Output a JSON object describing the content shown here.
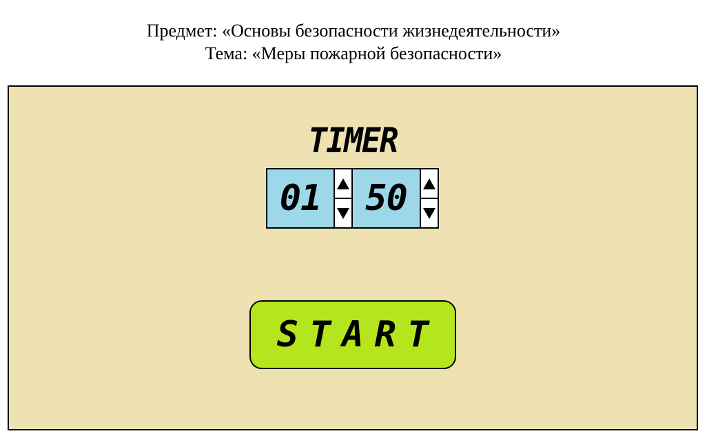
{
  "header": {
    "subject": "Предмет: «Основы безопасности жизнедеятельности»",
    "topic": "Тема: «Меры пожарной безопасности»"
  },
  "timer": {
    "title": "TIMER",
    "minutes": "01",
    "seconds": "50",
    "start_label": "START"
  },
  "colors": {
    "panel_background": "#efe2b2",
    "display_background": "#9dd8ea",
    "start_button": "#b5e61d"
  },
  "icons": {
    "increment": "triangle-up-icon",
    "decrement": "triangle-down-icon"
  }
}
